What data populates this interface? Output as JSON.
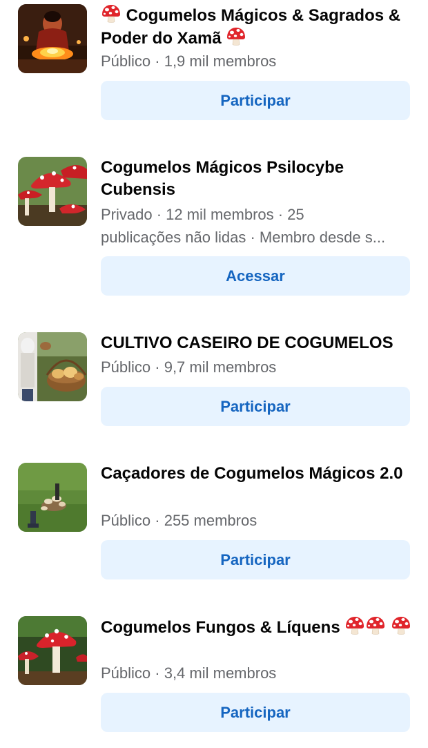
{
  "groups": [
    {
      "title_prefix_icon": "mushroom-emoji",
      "title": "Cogumelos Mágicos & Sagrados & Poder do Xamã",
      "title_suffix_icons": [
        "mushroom-emoji"
      ],
      "meta_line1": "Público · 1,9 mil membros",
      "meta_line2": "",
      "button_label": "Participar",
      "thumbnail": "shaman-fire-photo"
    },
    {
      "title": "Cogumelos Mágicos Psilocybe Cubensis",
      "meta_line1": "Privado · 12 mil membros · 25",
      "meta_line2": "publicações não lidas · Membro desde s...",
      "button_label": "Acessar",
      "thumbnail": "red-mushrooms-photo"
    },
    {
      "title": "CULTIVO CASEIRO DE COGUMELOS",
      "meta_line1": "Público · 9,7 mil membros",
      "meta_line2": "",
      "button_label": "Participar",
      "thumbnail": "mushroom-basket-photo"
    },
    {
      "title": "Caçadores de Cogumelos Mágicos 2.0",
      "meta_line1": "Público · 255 membros",
      "meta_line2": "",
      "button_label": "Participar",
      "thumbnail": "mushrooms-on-grass-photo"
    },
    {
      "title": "Cogumelos Fungos & Líquens",
      "title_suffix_icons": [
        "mushroom-emoji",
        "mushroom-emoji",
        "mushroom-emoji"
      ],
      "meta_line1": "Público · 3,4 mil membros",
      "meta_line2": "",
      "button_label": "Participar",
      "thumbnail": "fly-agaric-photo"
    }
  ],
  "colors": {
    "button_bg": "#e7f3ff",
    "button_text": "#1565c0",
    "meta_text": "#65676b",
    "title_text": "#050505"
  }
}
